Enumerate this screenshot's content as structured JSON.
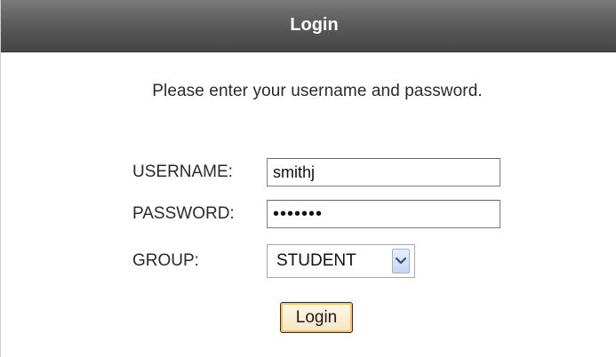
{
  "header": {
    "title": "Login"
  },
  "instructions": "Please enter your username and password.",
  "form": {
    "username": {
      "label": "USERNAME:",
      "value": "smithj"
    },
    "password": {
      "label": "PASSWORD:",
      "value": "•••••••"
    },
    "group": {
      "label": "GROUP:",
      "value": "STUDENT",
      "icon": "chevron-down-icon"
    },
    "submit_label": "Login"
  },
  "colors": {
    "header_top": "#7a7a7a",
    "header_bottom": "#454545",
    "button_border": "#2f2f2f",
    "button_focus": "#f2c066",
    "select_arrow_bg": "#c6d6f3"
  }
}
